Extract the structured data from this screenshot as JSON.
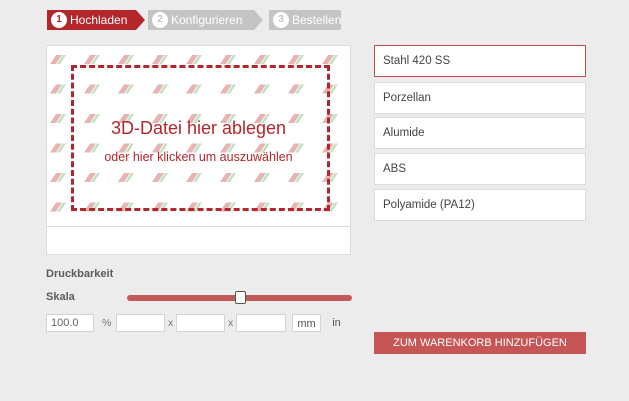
{
  "steps": [
    {
      "num": "1",
      "label": "Hochladen",
      "state": "active"
    },
    {
      "num": "2",
      "label": "Konfigurieren",
      "state": "inactive"
    },
    {
      "num": "3",
      "label": "Bestellen",
      "state": "inactive"
    }
  ],
  "upload": {
    "title": "3D-Datei hier ablegen",
    "subtitle": "oder hier klicken um auszuwählen"
  },
  "printability": {
    "label": "Druckbarkeit"
  },
  "scale": {
    "label": "Skala",
    "slider_fraction": 0.5,
    "value": "100.0",
    "percent_symbol": "%",
    "dim_x": "",
    "dim_y": "",
    "dim_z": "",
    "separator": "x",
    "units": [
      "mm",
      "in"
    ],
    "selected_unit": "mm"
  },
  "materials": [
    {
      "label": "Stahl 420 SS",
      "selected": true
    },
    {
      "label": "Porzellan",
      "selected": false
    },
    {
      "label": "Alumide",
      "selected": false
    },
    {
      "label": "ABS",
      "selected": false
    },
    {
      "label": "Polyamide (PA12)",
      "selected": false
    }
  ],
  "cart_button": {
    "label": "ZUM WARENKORB HINZUFÜGEN"
  },
  "colors": {
    "accent": "#b3262c",
    "cart_button": "#c65656",
    "step_inactive": "#c4c4c4",
    "pattern_red": "#e8b3b3",
    "pattern_green": "#bfe2bf"
  }
}
